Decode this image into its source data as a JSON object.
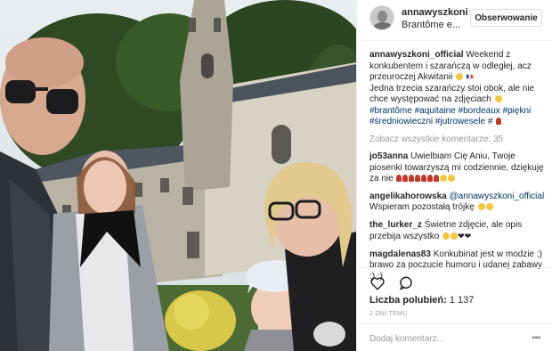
{
  "post": {
    "username": "annawyszkoni",
    "location": "Brantôme e...",
    "follow_label": "Obserwowanie"
  },
  "caption": {
    "user": "annawyszkoni_official",
    "text_1": " Weekend z konkubentem i szarańczą w odległej, acz przeuroczej Akwitanii ",
    "text_2": " Jedna trzecia szarańczy stoi obok, ale nie chce występować na zdjęciach ",
    "hashtags": "#brantôme #aquitaine #bordeaux #piękni #średniowieczni #jutrowesele #"
  },
  "view_all": "Zobacz wszystkie komentarze: 35",
  "comments": [
    {
      "user": "jo53anna",
      "text": " Uwielbiam Cię Aniu, Twoje piosenki towarzyszą mi codziennie, dziękuję za nie "
    },
    {
      "user": "angelikahorowska",
      "mention": " @annawyszkoni_official",
      "text": " Wspieram pozostałą trójkę "
    },
    {
      "user": "the_lurker_z",
      "text": " Świetne zdjęcie, ale opis przebija wszystko "
    },
    {
      "user": "magdalenas83",
      "text": " Konkubinat jest w modzie ;) brawo za poczucie humoru i udanej zabawy :) :)"
    }
  ],
  "likes": {
    "label": "Liczba polubień:",
    "count": "1 137"
  },
  "time_ago": "2 DNI TEMU",
  "add_comment_placeholder": "Dodaj komentarz...",
  "more_options": "•••",
  "icons": {
    "like": "heart-outline-icon",
    "comment": "speech-bubble-icon"
  },
  "colors": {
    "link": "#003569",
    "muted": "#999999",
    "border": "#efefef",
    "text": "#262626"
  }
}
